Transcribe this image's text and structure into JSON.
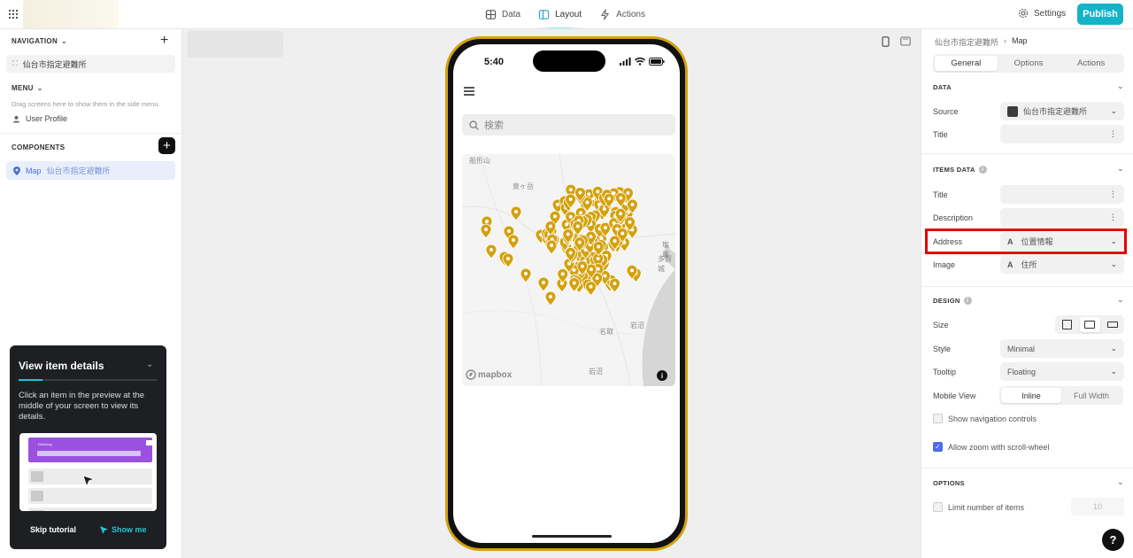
{
  "topbar": {
    "tabs": [
      {
        "label": "Data",
        "icon": "table-icon"
      },
      {
        "label": "Layout",
        "icon": "layout-icon"
      },
      {
        "label": "Actions",
        "icon": "lightning-icon"
      }
    ],
    "settings_label": "Settings",
    "publish_label": "Publish",
    "accent": "#15b3c8"
  },
  "left": {
    "navigation_heading": "NAVIGATION",
    "nav_items": [
      {
        "label": "仙台市指定避難所"
      }
    ],
    "menu_heading": "MENU",
    "menu_hint": "Drag screens here to show them in the side menu.",
    "menu_items": [
      {
        "label": "User Profile"
      }
    ],
    "components_heading": "COMPONENTS",
    "components": [
      {
        "label": "Map",
        "sub": "仙台市指定避難所"
      }
    ]
  },
  "tutorial": {
    "title": "View item details",
    "text": "Click an item in the preview at the middle of your screen to view its details.",
    "preview_title": "Directory",
    "skip_label": "Skip tutorial",
    "show_label": "Show me",
    "progress": 0.17
  },
  "phone": {
    "time": "5:40",
    "search_placeholder": "検索",
    "map_labels": [
      "船形山",
      "泉ヶ岳",
      "富谷",
      "塩釜",
      "多賀城",
      "名取",
      "岩沼",
      "角田",
      "岩沼"
    ],
    "map_labels_shown": [
      "船形山",
      "泉ヶ岳",
      "富谷",
      "塩竈",
      "多賀城",
      "名取",
      "岩沼",
      "岩沼"
    ],
    "attribution": "mapbox",
    "pin_color": "#d4a10e"
  },
  "right": {
    "breadcrumb": [
      "仙台市指定避難所",
      "Map"
    ],
    "tabs": [
      "General",
      "Options",
      "Actions"
    ],
    "data_heading": "DATA",
    "source_label": "Source",
    "source_value": "仙台市指定避難所",
    "title_label": "Title",
    "items_data_heading": "ITEMS DATA",
    "items_title_label": "Title",
    "description_label": "Description",
    "address_label": "Address",
    "address_value": "位置情報",
    "image_label": "Image",
    "image_value": "住所",
    "design_heading": "DESIGN",
    "size_label": "Size",
    "style_label": "Style",
    "style_value": "Minimal",
    "tooltip_label": "Tooltip",
    "tooltip_value": "Floating",
    "mobile_view_label": "Mobile View",
    "mobile_view_options": [
      "Inline",
      "Full Width"
    ],
    "show_nav_label": "Show navigation controls",
    "allow_zoom_label": "Allow zoom with scroll-wheel",
    "options_heading": "OPTIONS",
    "limit_label": "Limit number of items",
    "limit_placeholder": "10",
    "help_label": "?"
  }
}
